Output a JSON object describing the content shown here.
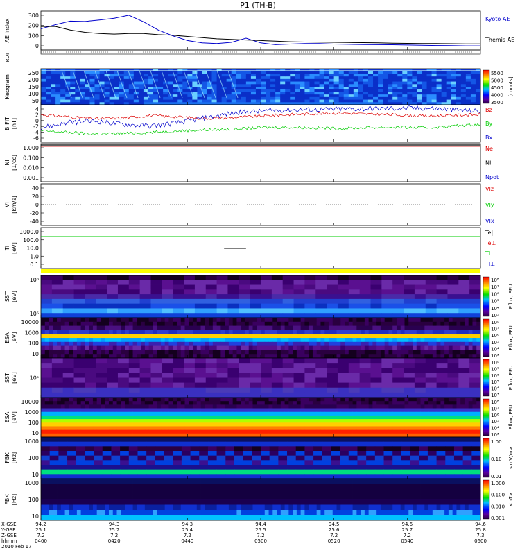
{
  "title": "P1  (TH-B)",
  "chart_data": {
    "type": "multi-panel-timeseries",
    "time_axis": {
      "tick_labels": [
        "0400",
        "0420",
        "0440",
        "0500",
        "0520",
        "0540",
        "0600"
      ],
      "hhmm_minutes": [
        0,
        20,
        40,
        60,
        80,
        100,
        120
      ],
      "x_gse": [
        "94.2",
        "94.3",
        "94.3",
        "94.4",
        "94.5",
        "94.6",
        "94.6"
      ],
      "y_gse": [
        "25.1",
        "25.2",
        "25.4",
        "25.5",
        "25.6",
        "25.7",
        "25.8"
      ],
      "z_gse": [
        "7.2",
        "7.2",
        "7.2",
        "7.2",
        "7.2",
        "7.2",
        "7.3"
      ],
      "row_labels": [
        "X-GSE",
        "Y-GSE",
        "Z-GSE",
        "hhmm"
      ],
      "date": "2010 Feb 17"
    },
    "panels": [
      {
        "id": "ae",
        "ylabel": "AE Index",
        "yticks": [
          "300",
          "200",
          "100",
          "0"
        ],
        "ylim": [
          0,
          330
        ],
        "series": [
          {
            "name": "Kyoto AE",
            "color": "#0000cc",
            "t": [
              0,
              4,
              8,
              12,
              16,
              20,
              24,
              28,
              32,
              36,
              40,
              44,
              48,
              52,
              56,
              60,
              64,
              68,
              72,
              76,
              80,
              84,
              88,
              92,
              96,
              100,
              104,
              108,
              112,
              116,
              120
            ],
            "values": [
              180,
              215,
              245,
              242,
              255,
              270,
              295,
              240,
              170,
              120,
              80,
              60,
              55,
              65,
              100,
              60,
              45,
              50,
              55,
              55,
              50,
              48,
              46,
              45,
              44,
              42,
              40,
              38,
              37,
              35,
              35
            ]
          },
          {
            "name": "Themis AE",
            "color": "#000000",
            "t": [
              0,
              4,
              8,
              12,
              16,
              20,
              24,
              28,
              32,
              36,
              40,
              44,
              48,
              52,
              56,
              60,
              64,
              68,
              72,
              76,
              80,
              84,
              88,
              92,
              96,
              100,
              104,
              108,
              112,
              116,
              120
            ],
            "values": [
              200,
              200,
              170,
              150,
              140,
              135,
              140,
              140,
              130,
              125,
              115,
              105,
              95,
              90,
              85,
              80,
              75,
              70,
              68,
              66,
              65,
              63,
              62,
              60,
              58,
              56,
              55,
              54,
              53,
              52,
              52
            ]
          }
        ]
      },
      {
        "id": "roi",
        "ylabel": "ROI"
      },
      {
        "id": "keogram",
        "ylabel": "Keogram",
        "yticks": [
          "250",
          "200",
          "150",
          "100",
          "50"
        ],
        "colorbar_ticks": [
          "5500",
          "5000",
          "4500",
          "4000",
          "3500"
        ],
        "colorbar_unit": "[counts]"
      },
      {
        "id": "bfield",
        "ylabel": "B FIT",
        "yunit": "[nT]",
        "yticks": [
          "4",
          "2",
          "0",
          "-2",
          "-4",
          "-6"
        ],
        "ylim": [
          -7,
          4.5
        ],
        "series": [
          {
            "name": "Bz",
            "color": "#dd0000",
            "t_start": 0,
            "t_end": 120,
            "level": [
              1.5,
              0.8,
              0.2,
              0.5,
              1.2,
              0.8,
              0.3,
              0.6,
              1.0,
              1.5,
              1.8,
              2.0,
              1.6,
              1.4,
              1.0,
              1.3,
              1.5
            ]
          },
          {
            "name": "By",
            "color": "#00cc00",
            "t_start": 0,
            "t_end": 120,
            "level": [
              -3.5,
              -4.0,
              -4.5,
              -4.3,
              -4.0,
              -3.5,
              -3.2,
              -3.0,
              -2.5,
              -2.4,
              -2.6,
              -2.8,
              -2.5,
              -2.4,
              -2.6,
              -2.0,
              -1.5
            ]
          },
          {
            "name": "Bx",
            "color": "#0000cc",
            "t_start": 0,
            "t_end": 120,
            "level": [
              -2.5,
              -1.0,
              -0.5,
              -1.5,
              -2.0,
              -1.0,
              0.5,
              2.0,
              2.5,
              3.0,
              3.0,
              3.2,
              3.3,
              3.4,
              3.5,
              3.0,
              2.5
            ]
          }
        ]
      },
      {
        "id": "density",
        "ylabel": "NI",
        "yunit": "[1/cc]",
        "yticks": [
          "1.000",
          "0.100",
          "0.010",
          "0.001"
        ],
        "legend": [
          {
            "name": "Ne",
            "color": "#dd0000"
          },
          {
            "name": "NI",
            "color": "#000000"
          },
          {
            "name": "Npot",
            "color": "#0000cc"
          }
        ]
      },
      {
        "id": "velocity",
        "ylabel": "VI",
        "yunit": "[km/s]",
        "yticks": [
          "40",
          "20",
          "0",
          "-20",
          "-40"
        ],
        "legend": [
          {
            "name": "VIz",
            "color": "#dd0000"
          },
          {
            "name": "VIy",
            "color": "#00cc00"
          },
          {
            "name": "VIx",
            "color": "#0000cc"
          }
        ]
      },
      {
        "id": "temperature",
        "ylabel": "TI",
        "yunit": "[eV]",
        "yticks": [
          "1000.0",
          "100.0",
          "10.0",
          "1.0",
          "0.1"
        ],
        "legend": [
          {
            "name": "Te||",
            "color": "#000000"
          },
          {
            "name": "Te⊥",
            "color": "#dd0000"
          },
          {
            "name": "TI",
            "color": "#00cc00"
          },
          {
            "name": "TI⊥",
            "color": "#0000cc"
          }
        ]
      },
      {
        "id": "sst_e",
        "ylabel": "SST",
        "yunit": "[eV]",
        "yticks": [
          "10⁶",
          "10⁵"
        ],
        "colorbar_ticks": [
          "10⁸",
          "10⁷",
          "10⁶",
          "10⁵",
          "10⁴",
          "10³"
        ],
        "colorbar_unit": "Eflux, EFU"
      },
      {
        "id": "esa_e",
        "ylabel": "ESA",
        "yunit": "[eV]",
        "yticks": [
          "10000",
          "1000",
          "100",
          "10"
        ],
        "colorbar_ticks": [
          "10⁸",
          "10⁷",
          "10⁶",
          "10⁵",
          "10⁴",
          "10³"
        ],
        "colorbar_unit": "Eflux, EFU"
      },
      {
        "id": "sst_i",
        "ylabel": "SST",
        "yunit": "[eV]",
        "yticks": [
          "10⁵"
        ],
        "colorbar_ticks": [
          "10⁸",
          "10⁷",
          "10⁶",
          "10⁵",
          "10⁴",
          "10³"
        ],
        "colorbar_unit": "Eflux, EFU"
      },
      {
        "id": "esa_i",
        "ylabel": "ESA",
        "yunit": "[eV]",
        "yticks": [
          "10000",
          "1000",
          "100",
          "10"
        ],
        "colorbar_ticks": [
          "10⁸",
          "10⁷",
          "10⁶",
          "10⁵",
          "10⁴",
          "10³"
        ],
        "colorbar_unit": "Eflux, EFU"
      },
      {
        "id": "fbk_e",
        "ylabel": "FBK",
        "yunit": "[Hz]",
        "yticks": [
          "1000",
          "100",
          "10"
        ],
        "colorbar_ticks": [
          "1.00",
          "0.10",
          "0.01"
        ],
        "colorbar_unit": "<mV/m>"
      },
      {
        "id": "fbk_b",
        "ylabel": "FBK",
        "yunit": "[Hz]",
        "yticks": [
          "1000",
          "100",
          "10"
        ],
        "colorbar_ticks": [
          "1.000",
          "0.100",
          "0.010",
          "0.001"
        ],
        "colorbar_unit": "<nT>"
      }
    ]
  }
}
